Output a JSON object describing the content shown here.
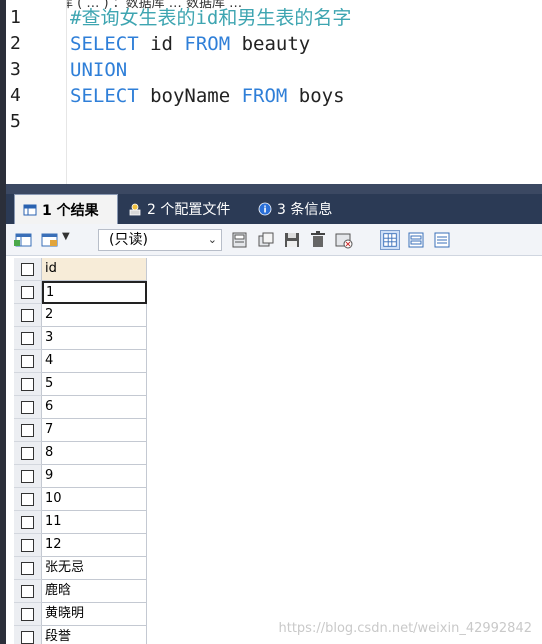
{
  "editor": {
    "top_cut_text": "当前数据库 ( … ) ：数据库 … 数据库 …",
    "lines": [
      {
        "num": "1",
        "tokens": [
          {
            "t": "#查询女生表的id和男生表的名字",
            "c": "cm"
          }
        ]
      },
      {
        "num": "2",
        "tokens": [
          {
            "t": "SELECT",
            "c": "kw"
          },
          {
            "t": " id ",
            "c": "id"
          },
          {
            "t": "FROM",
            "c": "kw"
          },
          {
            "t": " beauty",
            "c": "id"
          }
        ]
      },
      {
        "num": "3",
        "tokens": [
          {
            "t": "UNION",
            "c": "kw"
          }
        ]
      },
      {
        "num": "4",
        "tokens": [
          {
            "t": "SELECT",
            "c": "kw"
          },
          {
            "t": " boyName ",
            "c": "id"
          },
          {
            "t": "FROM",
            "c": "kw"
          },
          {
            "t": " boys",
            "c": "id"
          }
        ]
      },
      {
        "num": "5",
        "tokens": []
      }
    ]
  },
  "tabs": {
    "results": "1 个结果",
    "profiles": "2 个配置文件",
    "messages": "3 条信息"
  },
  "toolbar": {
    "mode_value": "(只读)"
  },
  "grid": {
    "column_header": "id",
    "rows": [
      "1",
      "2",
      "3",
      "4",
      "5",
      "6",
      "7",
      "8",
      "9",
      "10",
      "11",
      "12",
      "张无忌",
      "鹿晗",
      "黄晓明",
      "段誉"
    ]
  },
  "watermark": "https://blog.csdn.net/weixin_42992842",
  "colors": {
    "keyword": "#2f7fd8",
    "comment": "#3ea5b1",
    "tabs_bar": "#2b3a55",
    "header_cell": "#f7ecd8"
  }
}
